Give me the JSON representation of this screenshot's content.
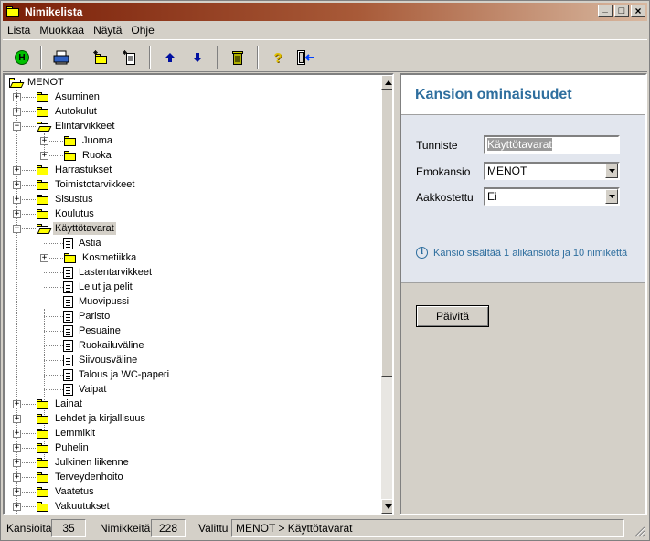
{
  "window": {
    "title": "Nimikelista"
  },
  "title_buttons": [
    "_",
    "□",
    "×"
  ],
  "menu": [
    {
      "label": "Lista"
    },
    {
      "label": "Muokkaa"
    },
    {
      "label": "Näytä"
    },
    {
      "label": "Ohje"
    }
  ],
  "toolbar": {
    "home_glyph": "H",
    "help_glyph": "?"
  },
  "tree": {
    "root": "MENOT",
    "categories": [
      "Asuminen",
      "Autokulut",
      "Elintarvikkeet",
      "Juoma",
      "Ruoka",
      "Harrastukset",
      "Toimistotarvikkeet",
      "Sisustus",
      "Koulutus",
      "Käyttötavarat",
      "Astia",
      "Kosmetiikka",
      "Lastentarvikkeet",
      "Lelut ja pelit",
      "Muovipussi",
      "Paristo",
      "Pesuaine",
      "Ruokailuväline",
      "Siivousväline",
      "Talous ja WC-paperi",
      "Vaipat",
      "Lainat",
      "Lehdet ja kirjallisuus",
      "Lemmikit",
      "Puhelin",
      "Julkinen liikenne",
      "Terveydenhoito",
      "Vaatetus",
      "Vakuutukset"
    ],
    "selected": "Käyttötavarat"
  },
  "panel": {
    "title": "Kansion ominaisuudet",
    "fields": {
      "tunniste_label": "Tunniste",
      "tunniste_value": "Käyttötavarat",
      "emokansio_label": "Emokansio",
      "emokansio_value": "MENOT",
      "aakkostettu_label": "Aakkostettu",
      "aakkostettu_value": "Ei"
    },
    "info": "Kansio sisältää 1 alikansiota ja 10 nimikettä",
    "update_label": "Päivitä"
  },
  "status": {
    "kansioita_label": "Kansioita",
    "kansioita_value": "35",
    "nimikkeita_label": "Nimikkeitä",
    "nimikkeita_value": "228",
    "valittu_label": "Valittu",
    "valittu_value": "MENOT > Käyttötavarat"
  },
  "colors": {
    "titlebar_start": "#7a1f08",
    "accent_blue": "#2e6e9e",
    "form_bg": "#e2e6ee",
    "folder_yellow": "#ffff00"
  }
}
